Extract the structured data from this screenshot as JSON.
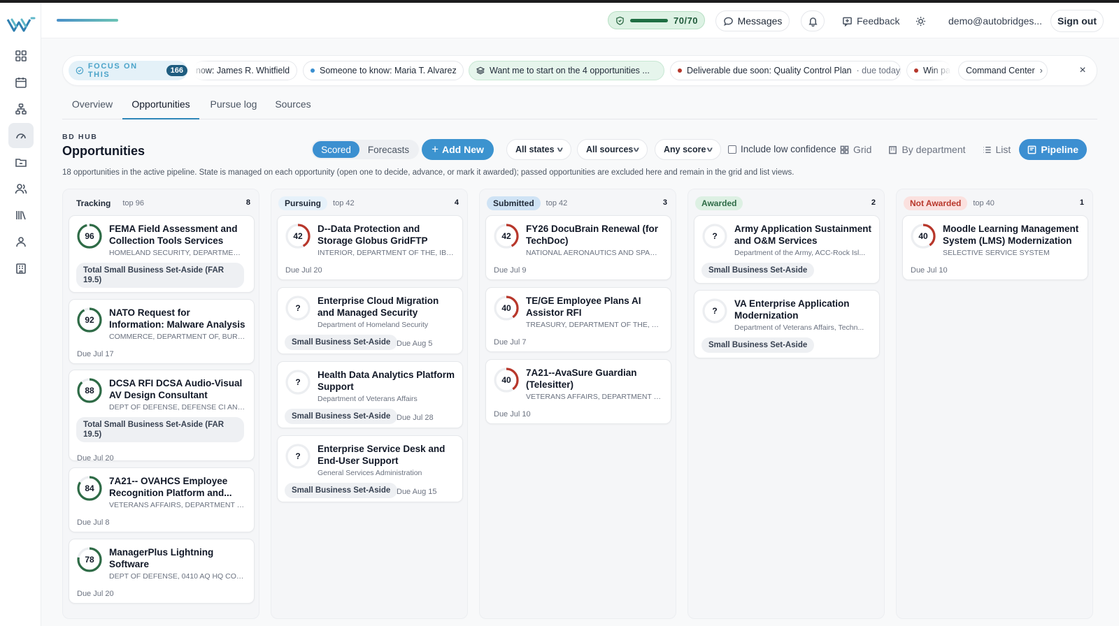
{
  "header": {
    "score": "70/70",
    "messages": "Messages",
    "feedback": "Feedback",
    "user": "demo@autobridges...",
    "sign_out": "Sign out"
  },
  "focus": {
    "label": "FOCUS ON THIS",
    "count": "166",
    "chips": [
      {
        "text": "now: James R. Whitfield"
      },
      {
        "text": "Someone to know: Maria T. Alvarez",
        "dot": "#3a8fd0"
      },
      {
        "text": "Want me to start on the 4 opportunities ..."
      },
      {
        "text": "Deliverable due soon: Quality Control Plan",
        "suffix": "· due today",
        "dot": "#b5362b"
      },
      {
        "text": "Win pa",
        "dot": "#b5362b"
      },
      {
        "text": "Command Center"
      }
    ]
  },
  "tabs": [
    "Overview",
    "Opportunities",
    "Pursue log",
    "Sources"
  ],
  "hub": {
    "small": "BD HUB",
    "title": "Opportunities",
    "scored": "Scored",
    "forecasts": "Forecasts",
    "add_new": "Add New",
    "states": "All states",
    "sources": "All sources",
    "score": "Any score",
    "low_conf": "Include low confidence",
    "views": {
      "grid": "Grid",
      "dept": "By department",
      "list": "List",
      "pipeline": "Pipeline"
    },
    "description": "18 opportunities in the active pipeline. State is managed on each opportunity (open one to decide, advance, or mark it awarded); passed opportunities are excluded here and remain in the grid and list views."
  },
  "colors": {
    "accent": "#3c93cf",
    "ring_green": "#2e6b46",
    "ring_red": "#b8372b"
  },
  "columns": [
    {
      "stage": "Tracking",
      "top": "top 96",
      "count": "8",
      "cards": [
        {
          "score": "96",
          "title": "FEMA Field Assessment and Collection Tools Services Dat...",
          "agency": "HOMELAND SECURITY, DEPARTMENT ...",
          "tag": "Total Small Business Set-Aside (FAR 19.5)",
          "due": ""
        },
        {
          "score": "92",
          "title": "NATO Request for Information: Malware Analysis and...",
          "agency": "COMMERCE, DEPARTMENT OF, BURE...",
          "tag": "",
          "due": "Due Jul 17"
        },
        {
          "score": "88",
          "title": "DCSA RFI DCSA Audio-Visual AV Design Consultant",
          "agency": "DEPT OF DEFENSE, DEFENSE CI AND ...",
          "tag": "Total Small Business Set-Aside (FAR 19.5)",
          "due": "Due Jul 20"
        },
        {
          "score": "84",
          "title": "7A21-- OVAHCS Employee Recognition Platform and...",
          "agency": "VETERANS AFFAIRS, DEPARTMENT OF...",
          "tag": "",
          "due": "Due Jul 8"
        },
        {
          "score": "78",
          "title": "ManagerPlus Lightning Software",
          "agency": "DEPT OF DEFENSE, 0410 AQ HQ CON...",
          "tag": "",
          "due": "Due Jul 20"
        }
      ]
    },
    {
      "stage": "Pursuing",
      "top": "top 42",
      "count": "4",
      "cards": [
        {
          "score": "42",
          "title": "D--Data Protection and Storage Globus GridFTP",
          "agency": "INTERIOR, DEPARTMENT OF THE, IBC ...",
          "tag": "",
          "due": "Due Jul 20"
        },
        {
          "score": "?",
          "title": "Enterprise Cloud Migration and Managed Security Services",
          "agency": "Department of Homeland Security",
          "tag": "Small Business Set-Aside",
          "due": "Due Aug 5"
        },
        {
          "score": "?",
          "title": "Health Data Analytics Platform Support",
          "agency": "Department of Veterans Affairs",
          "tag": "Small Business Set-Aside",
          "due": "Due Jul 28"
        },
        {
          "score": "?",
          "title": "Enterprise Service Desk and End-User Support",
          "agency": "General Services Administration",
          "tag": "Small Business Set-Aside",
          "due": "Due Aug 15"
        }
      ]
    },
    {
      "stage": "Submitted",
      "top": "top 42",
      "count": "3",
      "cards": [
        {
          "score": "42",
          "title": "FY26 DocuBrain Renewal (for TechDoc)",
          "agency": "NATIONAL AERONAUTICS AND SPACE...",
          "tag": "",
          "due": "Due Jul 9"
        },
        {
          "score": "40",
          "title": "TE/GE Employee Plans AI Assistor RFI",
          "agency": "TREASURY, DEPARTMENT OF THE, TA...",
          "tag": "",
          "due": "Due Jul 7"
        },
        {
          "score": "40",
          "title": "7A21--AvaSure Guardian (Telesitter)",
          "agency": "VETERANS AFFAIRS, DEPARTMENT OF...",
          "tag": "",
          "due": "Due Jul 10"
        }
      ]
    },
    {
      "stage": "Awarded",
      "top": "",
      "count": "2",
      "cards": [
        {
          "score": "?",
          "title": "Army Application Sustainment and O&M Services",
          "agency": "Department of the Army, ACC-Rock Isl...",
          "tag": "Small Business Set-Aside",
          "due": ""
        },
        {
          "score": "?",
          "title": "VA Enterprise Application Modernization",
          "agency": "Department of Veterans Affairs, Techn...",
          "tag": "Small Business Set-Aside",
          "due": ""
        }
      ]
    },
    {
      "stage": "Not Awarded",
      "top": "top 40",
      "count": "1",
      "cards": [
        {
          "score": "40",
          "title": "Moodle Learning Management System (LMS) Modernization",
          "agency": "SELECTIVE SERVICE SYSTEM",
          "tag": "",
          "due": "Due Jul 10"
        }
      ]
    }
  ]
}
